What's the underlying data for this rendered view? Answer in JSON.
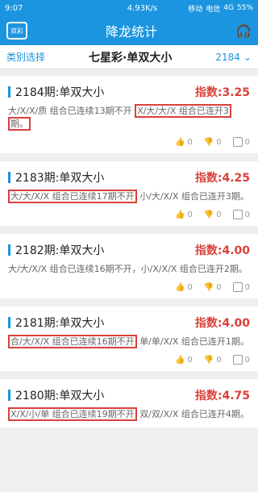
{
  "status": {
    "time": "9:07",
    "network": "4.93K/s",
    "carrier1": "移动",
    "carrier2": "电信",
    "net2": "4G",
    "battery": "55%"
  },
  "header": {
    "title": "降龙统计",
    "logo": "双彩"
  },
  "subheader": {
    "left": "类别选择",
    "center": "七星彩·单双大小",
    "right": "2184"
  },
  "cards": [
    {
      "title": "2184期:单双大小",
      "index": "指数:3.25",
      "desc_parts": [
        {
          "text": "大/X/X/质 组合已连续13期不开",
          "hl": false
        },
        {
          "text": "X/大/大/X 组合已连开3",
          "hl": true
        },
        {
          "text": "期。",
          "hl": true
        }
      ],
      "likes": "0",
      "dislikes": "0",
      "comments": "0"
    },
    {
      "title": "2183期:单双大小",
      "index": "指数:4.25",
      "desc_parts": [
        {
          "text": "大/大/X/X 组合已连续17期不开",
          "hl": true
        },
        {
          "text": "小/大/X/X 组合已连开3期。",
          "hl": false
        }
      ],
      "likes": "0",
      "dislikes": "0",
      "comments": "0"
    },
    {
      "title": "2182期:单双大小",
      "index": "指数:4.00",
      "desc_parts": [
        {
          "text": "大/大/X/X 组合已连续16期不开，小/X/X/X 组合已连开2期。",
          "hl": false
        }
      ],
      "likes": "0",
      "dislikes": "0",
      "comments": "0"
    },
    {
      "title": "2181期:单双大小",
      "index": "指数:4.00",
      "desc_parts": [
        {
          "text": "合/大/X/X 组合已连续16期不开",
          "hl": true
        },
        {
          "text": "单/单/X/X 组合已连开1期。",
          "hl": false
        }
      ],
      "likes": "0",
      "dislikes": "0",
      "comments": "0"
    },
    {
      "title": "2180期:单双大小",
      "index": "指数:4.75",
      "desc_parts": [
        {
          "text": "X/X/小/单 组合已连续19期不开",
          "hl": true
        },
        {
          "text": "双/双/X/X 组合已连开4期。",
          "hl": false
        }
      ],
      "likes": "",
      "dislikes": "",
      "comments": ""
    }
  ]
}
